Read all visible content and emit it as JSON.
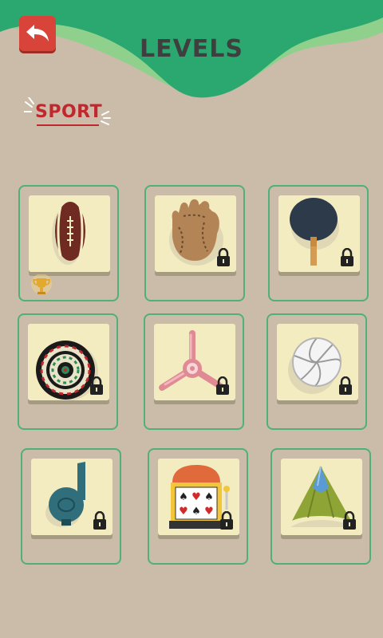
{
  "header": {
    "title": "LEVELS",
    "back_icon": "back-arrow-icon",
    "colors": {
      "wave_dark": "#2aa86f",
      "wave_light": "#8fd18c",
      "back_button": "#d9443a"
    }
  },
  "category": {
    "label": "SPORT",
    "color": "#c0282d"
  },
  "levels": [
    {
      "icon": "american-football-icon",
      "locked": false,
      "completed": true
    },
    {
      "icon": "baseball-glove-icon",
      "locked": true,
      "completed": false
    },
    {
      "icon": "ping-pong-paddle-icon",
      "locked": true,
      "completed": false
    },
    {
      "icon": "dartboard-icon",
      "locked": true,
      "completed": false
    },
    {
      "icon": "fidget-spinner-icon",
      "locked": true,
      "completed": false
    },
    {
      "icon": "volleyball-icon",
      "locked": true,
      "completed": false
    },
    {
      "icon": "whistle-icon",
      "locked": true,
      "completed": false
    },
    {
      "icon": "slot-machine-icon",
      "locked": true,
      "completed": false
    },
    {
      "icon": "badminton-shuttlecock-icon",
      "locked": true,
      "completed": false
    }
  ]
}
